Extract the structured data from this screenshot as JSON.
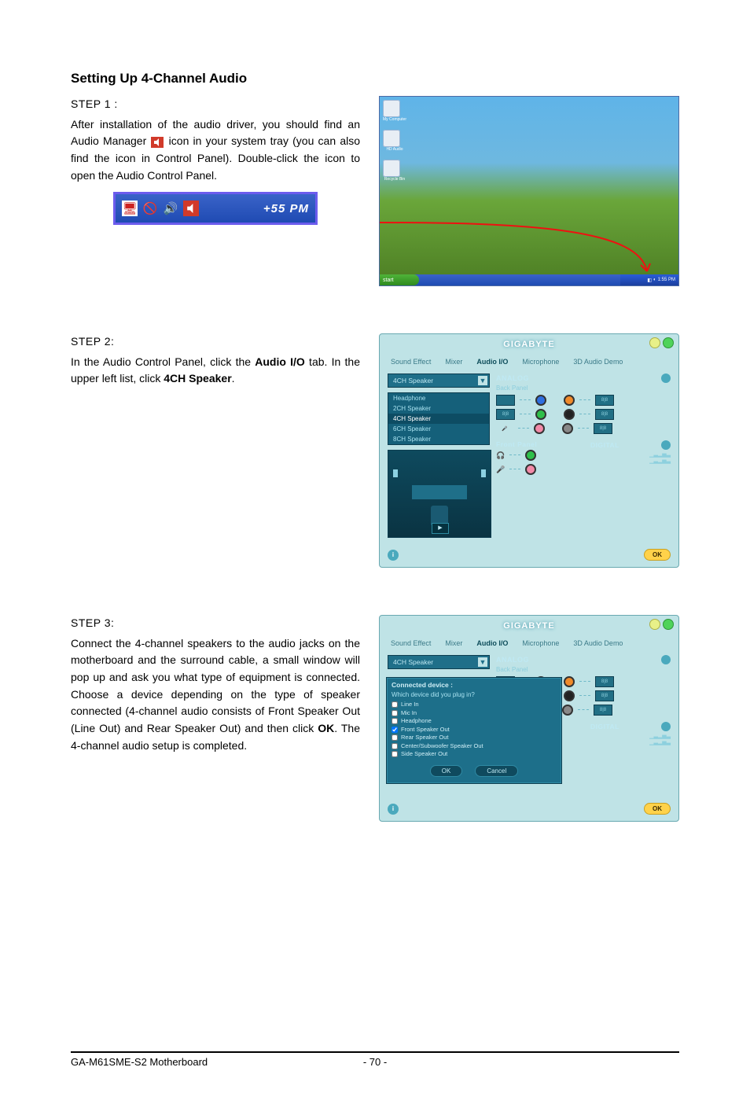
{
  "section_title": "Setting Up 4-Channel Audio",
  "step1": {
    "label": "STEP 1 :",
    "para_pre": "After installation of the audio driver, you should find an Audio Manager",
    "para_post": "icon in your system tray (you can also find the icon in Control Panel). Double-click the icon to open the Audio Control Panel.",
    "tray_time": "1:55 PM",
    "tray_time_display": "+55 PM",
    "desktop": {
      "start": "start",
      "icon_labels": [
        "My Computer",
        "HD Audio",
        "Recycle Bin"
      ]
    }
  },
  "step2": {
    "label": "STEP 2:",
    "para_html": "In the Audio Control Panel, click the <b>Audio I/O</b> tab. In the upper left list, click <b>4CH Speaker</b>."
  },
  "step3": {
    "label": "STEP 3:",
    "para_html": "Connect the 4-channel speakers to the audio jacks on the motherboard and the surround cable, a small window will pop up and ask you what type of equipment is connected. Choose a device depending on the type of speaker connected (4-channel audio consists of Front Speaker Out (Line Out) and Rear Speaker Out) and then click <b>OK</b>. The 4-channel audio setup is completed."
  },
  "audio_panel": {
    "brand": "GIGABYTE",
    "tabs": [
      "Sound Effect",
      "Mixer",
      "Audio I/O",
      "Microphone",
      "3D Audio Demo"
    ],
    "active_tab": "Audio I/O",
    "speaker_selected": "4CH Speaker",
    "speaker_options": [
      "Headphone",
      "2CH Speaker",
      "4CH Speaker",
      "6CH Speaker",
      "8CH Speaker"
    ],
    "analog_label": "ANALOG",
    "back_panel_label": "Back Panel",
    "front_panel_label": "Front Panel",
    "digital_label": "DIGITAL",
    "ok": "OK",
    "info_icon": "i"
  },
  "connected_dialog": {
    "header": "Connected device :",
    "question": "Which device did you plug in?",
    "options": [
      {
        "label": "Line In",
        "checked": false
      },
      {
        "label": "Mic In",
        "checked": false
      },
      {
        "label": "Headphone",
        "checked": false
      },
      {
        "label": "Front Speaker Out",
        "checked": true
      },
      {
        "label": "Rear Speaker Out",
        "checked": false
      },
      {
        "label": "Center/Subwoofer Speaker Out",
        "checked": false
      },
      {
        "label": "Side Speaker Out",
        "checked": false
      }
    ],
    "ok": "OK",
    "cancel": "Cancel"
  },
  "footer": {
    "model": "GA-M61SME-S2 Motherboard",
    "page": "- 70 -"
  }
}
